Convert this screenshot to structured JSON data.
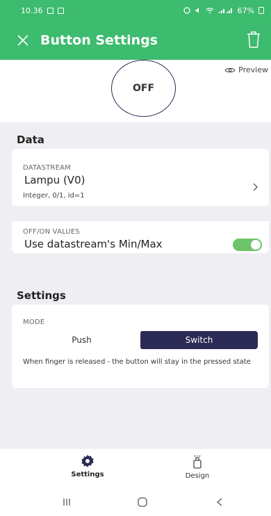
{
  "status_bar": {
    "time": "10.36",
    "battery": "67%",
    "icons": [
      "gallery-icon",
      "notification-icon",
      "alarm-icon",
      "mute-icon",
      "wifi-icon",
      "signal-icon",
      "battery-icon"
    ]
  },
  "app_bar": {
    "title": "Button Settings",
    "close_icon": "close-icon",
    "delete_icon": "trash-icon"
  },
  "preview": {
    "link_label": "Preview",
    "button_label": "OFF"
  },
  "data_section": {
    "title": "Data",
    "datastream_caption": "DATASTREAM",
    "datastream_name": "Lampu (V0)",
    "datastream_meta": "Integer, 0/1, id=1",
    "offon_caption": "OFF/ON VALUES",
    "offon_value": "Use datastream's Min/Max",
    "toggle_on": true
  },
  "settings_section": {
    "title": "Settings",
    "mode_caption": "MODE",
    "modes": [
      "Push",
      "Switch"
    ],
    "selected_mode": "Switch",
    "description": "When finger is released - the button will stay in the pressed state"
  },
  "bottom_nav": {
    "items": [
      {
        "label": "Settings",
        "icon": "gear-icon",
        "active": true
      },
      {
        "label": "Design",
        "icon": "design-icon",
        "active": false
      }
    ]
  },
  "colors": {
    "accent": "#3dbb6e",
    "dark_button": "#2b2b55",
    "toggle": "#6ec46b"
  }
}
